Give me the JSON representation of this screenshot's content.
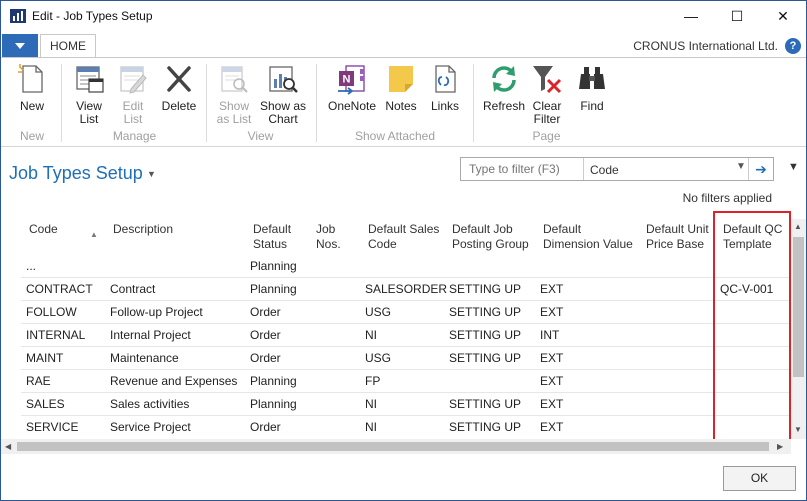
{
  "window": {
    "title": "Edit - Job Types Setup",
    "minimize": "—",
    "maximize": "☐",
    "close": "✕"
  },
  "ribbon_tabs": {
    "home": "HOME",
    "company": "CRONUS International Ltd.",
    "help": "?"
  },
  "ribbon": {
    "new": "New",
    "view_list": "View\nList",
    "edit_list": "Edit\nList",
    "delete": "Delete",
    "show_as_list": "Show\nas List",
    "show_as_chart": "Show as\nChart",
    "onenote": "OneNote",
    "notes": "Notes",
    "links": "Links",
    "refresh": "Refresh",
    "clear_filter": "Clear\nFilter",
    "find": "Find",
    "groups": {
      "new": "New",
      "manage": "Manage",
      "view": "View",
      "show_attached": "Show Attached",
      "page": "Page"
    }
  },
  "page": {
    "title": "Job Types Setup",
    "filter_placeholder": "Type to filter (F3)",
    "filter_field": "Code",
    "no_filters": "No filters applied"
  },
  "table": {
    "headers": {
      "code": "Code",
      "description": "Description",
      "default_status": "Default\nStatus",
      "job_nos": "Job\nNos.",
      "default_sales_code": "Default Sales\nCode",
      "posting_group": "Default Job\nPosting Group",
      "dimension_value": "Default\nDimension Value",
      "unit_price_base": "Default Unit\nPrice Base",
      "qc_template": "Default QC\nTemplate"
    },
    "rows": [
      {
        "code": "...",
        "description": "",
        "status": "Planning",
        "job_nos": "",
        "sales_code": "",
        "posting_group": "",
        "dimension": "",
        "price_base": "",
        "qc": ""
      },
      {
        "code": "CONTRACT",
        "description": "Contract",
        "status": "Planning",
        "job_nos": "",
        "sales_code": "SALESORDER",
        "posting_group": "SETTING UP",
        "dimension": "EXT",
        "price_base": "",
        "qc": "QC-V-001"
      },
      {
        "code": "FOLLOW",
        "description": "Follow-up Project",
        "status": "Order",
        "job_nos": "",
        "sales_code": "USG",
        "posting_group": "SETTING UP",
        "dimension": "EXT",
        "price_base": "",
        "qc": ""
      },
      {
        "code": "INTERNAL",
        "description": "Internal Project",
        "status": "Order",
        "job_nos": "",
        "sales_code": "NI",
        "posting_group": "SETTING UP",
        "dimension": "INT",
        "price_base": "",
        "qc": ""
      },
      {
        "code": "MAINT",
        "description": "Maintenance",
        "status": "Order",
        "job_nos": "",
        "sales_code": "USG",
        "posting_group": "SETTING UP",
        "dimension": "EXT",
        "price_base": "",
        "qc": ""
      },
      {
        "code": "RAE",
        "description": "Revenue and Expenses",
        "status": "Planning",
        "job_nos": "",
        "sales_code": "FP",
        "posting_group": "",
        "dimension": "EXT",
        "price_base": "",
        "qc": ""
      },
      {
        "code": "SALES",
        "description": "Sales activities",
        "status": "Planning",
        "job_nos": "",
        "sales_code": "NI",
        "posting_group": "SETTING UP",
        "dimension": "EXT",
        "price_base": "",
        "qc": ""
      },
      {
        "code": "SERVICE",
        "description": "Service Project",
        "status": "Order",
        "job_nos": "",
        "sales_code": "NI",
        "posting_group": "SETTING UP",
        "dimension": "EXT",
        "price_base": "",
        "qc": ""
      }
    ]
  },
  "footer": {
    "ok": "OK"
  },
  "colors": {
    "accent": "#1e6fb8",
    "file_button": "#2d6ab8",
    "highlight": "#d9242b"
  }
}
